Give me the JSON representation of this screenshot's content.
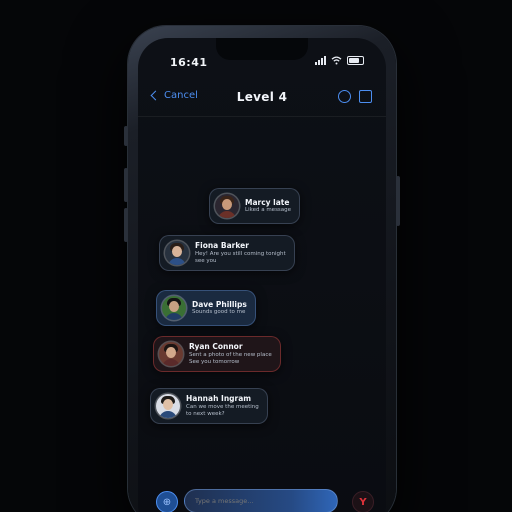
{
  "status_bar": {
    "time": "16:41"
  },
  "nav": {
    "back_label": "Cancel",
    "subtitle": "",
    "title": "Level 4"
  },
  "messages": [
    {
      "name": "Marcy late",
      "lines": [
        "Liked a message"
      ],
      "stamp": "",
      "style": "plain",
      "colors": {
        "hair": "#3a2418",
        "face": "#c99a7a",
        "torso": "#6b3028",
        "bg": "#2b2630"
      }
    },
    {
      "name": "Fiona Barker",
      "lines": [
        "Hey! Are you still coming tonight",
        "see you"
      ],
      "stamp": "",
      "style": "plain",
      "colors": {
        "hair": "#2a1e18",
        "face": "#d8b49a",
        "torso": "#2c4f86",
        "bg": "#27313e"
      }
    },
    {
      "name": "Dave Phillips",
      "lines": [
        "Sounds good to me"
      ],
      "stamp": "",
      "style": "blue",
      "colors": {
        "hair": "#141414",
        "face": "#c7a083",
        "torso": "#213c66",
        "bg": "#3a6f34"
      }
    },
    {
      "name": "Ryan Connor",
      "lines": [
        "Sent a photo of the new place",
        "See you tomorrow"
      ],
      "stamp": "",
      "style": "red",
      "colors": {
        "hair": "#1c1412",
        "face": "#d3a98b",
        "torso": "#5b2a2a",
        "bg": "#6a3a30"
      }
    },
    {
      "name": "Hannah Ingram",
      "lines": [
        "Can we move the meeting",
        "to next week?"
      ],
      "stamp": "",
      "style": "plain",
      "colors": {
        "hair": "#1d1a18",
        "face": "#e0c0a6",
        "torso": "#2a4a7a",
        "bg": "#d9dde6"
      }
    }
  ],
  "composer": {
    "placeholder": "Type a message...",
    "attach_glyph": "⊕",
    "send_glyph": "Y"
  }
}
